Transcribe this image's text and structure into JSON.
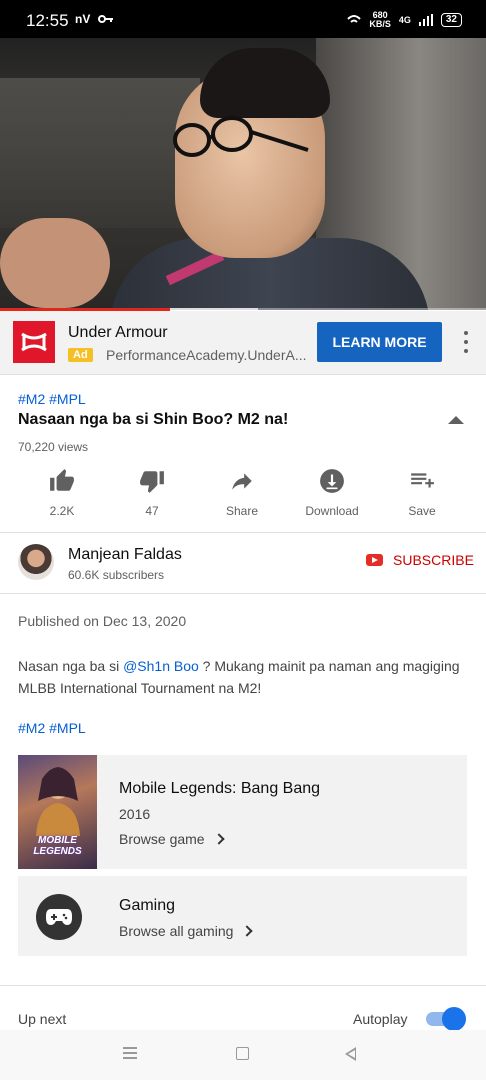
{
  "status_bar": {
    "time": "12:55",
    "left_icons": [
      "nV",
      "key-icon"
    ],
    "speed_value": "680",
    "speed_unit": "KB/S",
    "network": "4G",
    "battery": "32"
  },
  "player": {
    "progress_fraction": 0.35,
    "buffered_fraction": 0.53
  },
  "ad": {
    "brand": "Under Armour",
    "badge": "Ad",
    "url": "PerformanceAcademy.UnderA...",
    "cta": "LEARN MORE",
    "brand_color": "#e0172a",
    "cta_color": "#1565c0"
  },
  "video": {
    "hashtags": "#M2 #MPL",
    "title": "Nasaan nga ba si Shin Boo? M2 na!",
    "views": "70,220 views"
  },
  "actions": [
    {
      "icon": "thumbs-up-icon",
      "label": "2.2K"
    },
    {
      "icon": "thumbs-down-icon",
      "label": "47"
    },
    {
      "icon": "share-icon",
      "label": "Share"
    },
    {
      "icon": "download-icon",
      "label": "Download"
    },
    {
      "icon": "playlist-add-icon",
      "label": "Save"
    }
  ],
  "channel": {
    "name": "Manjean Faldas",
    "subscribers": "60.6K subscribers",
    "subscribe_label": "SUBSCRIBE"
  },
  "description": {
    "published": "Published on Dec 13, 2020",
    "text_before": "Nasan nga ba si ",
    "mention": "@Sh1n Boo",
    "text_after": " ? Mukang mainit pa naman ang magiging MLBB International Tournament na M2!",
    "tags": "#M2 #MPL"
  },
  "game_card": {
    "title": "Mobile Legends: Bang Bang",
    "year": "2016",
    "link": "Browse game",
    "thumb_text": "MOBILE LEGENDS"
  },
  "gaming_card": {
    "title": "Gaming",
    "link": "Browse all gaming"
  },
  "up_next": {
    "label": "Up next",
    "autoplay_label": "Autoplay",
    "autoplay_on": true
  }
}
